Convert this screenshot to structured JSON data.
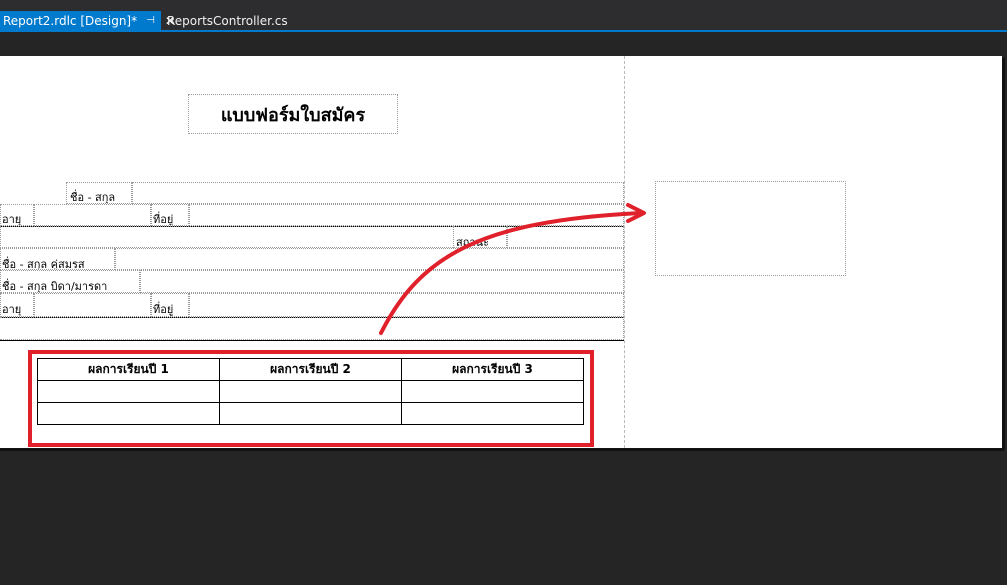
{
  "tabs": {
    "active": {
      "label": "Report2.rdlc [Design]*",
      "pin_icon": "pin-icon",
      "close_icon": "close-icon"
    },
    "inactive": {
      "label": "ReportsController.cs"
    }
  },
  "report": {
    "title": "แบบฟอร์มใบสมัคร",
    "fields": {
      "f1": "ชื่อ - สกุล",
      "f2": "อายุ",
      "f3": "ที่อยู่",
      "f4": "สถานะ",
      "f5": "ชื่อ - สกุล คู่สมรส",
      "f6": "ชื่อ - สกุล บิดา/มารดา",
      "f7": "อายุ",
      "f8": "ที่อยู่"
    },
    "table": {
      "headers": [
        "ผลการเรียนปี 1",
        "ผลการเรียนปี 2",
        "ผลการเรียนปี 3"
      ]
    }
  },
  "annotation": {
    "highlight_color": "#e0202a",
    "arrow_color": "#e0202a"
  }
}
